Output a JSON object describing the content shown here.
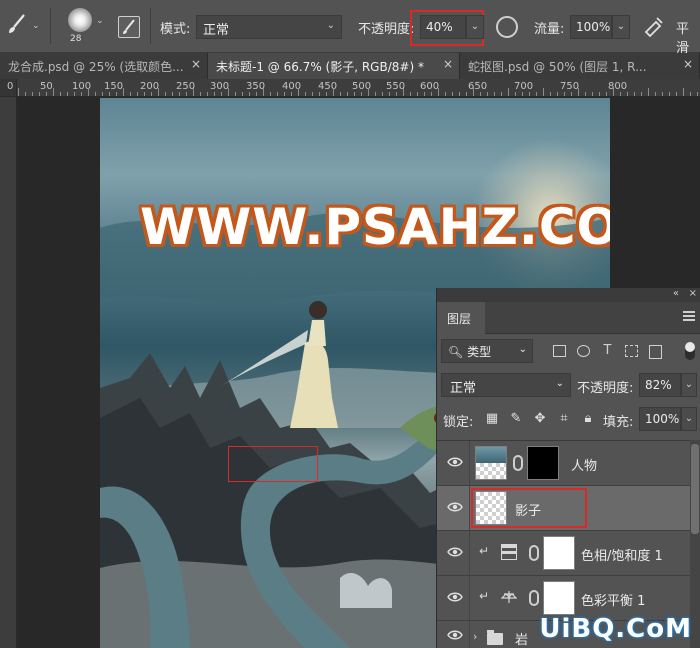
{
  "options_bar": {
    "brush_size": "28",
    "mode_label": "模式:",
    "mode_value": "正常",
    "opacity_label": "不透明度:",
    "opacity_value": "40%",
    "flow_label": "流量:",
    "flow_value": "100%",
    "smoothing_label": "平滑"
  },
  "tabs": [
    {
      "label": "龙合成.psd @ 25% (选取颜色...",
      "close": "×",
      "active": false
    },
    {
      "label": "未标题-1 @ 66.7% (影子, RGB/8#) *",
      "close": "×",
      "active": true
    },
    {
      "label": "蛇抠图.psd @ 50% (图层 1, R...",
      "close": "×",
      "active": false
    }
  ],
  "ruler": {
    "labels": [
      "0",
      "50",
      "100",
      "150",
      "200",
      "250",
      "300",
      "350",
      "400",
      "450",
      "500",
      "550",
      "600",
      "650",
      "700",
      "750",
      "800"
    ]
  },
  "canvas": {
    "watermark": "WWW.PSAHZ.COM"
  },
  "layers_panel": {
    "tab_title": "图层",
    "filter_kind": "类型",
    "blend_mode": "正常",
    "opacity_label": "不透明度:",
    "opacity_value": "82%",
    "lock_label": "锁定:",
    "fill_label": "填充:",
    "fill_value": "100%",
    "layers": [
      {
        "name": "人物",
        "type": "pixel-with-mask",
        "selected": false
      },
      {
        "name": "影子",
        "type": "pixel",
        "selected": true
      },
      {
        "name": "色相/饱和度 1",
        "type": "adjustment",
        "selected": false
      },
      {
        "name": "色彩平衡 1",
        "type": "adjustment",
        "selected": false
      },
      {
        "name": "岩",
        "type": "group",
        "selected": false
      }
    ]
  },
  "corner_watermark": "UiBQ.CoM",
  "colors": {
    "highlight_red": "#d92a2a",
    "watermark_orange": "#c4571a",
    "panel_bg": "#535353"
  }
}
